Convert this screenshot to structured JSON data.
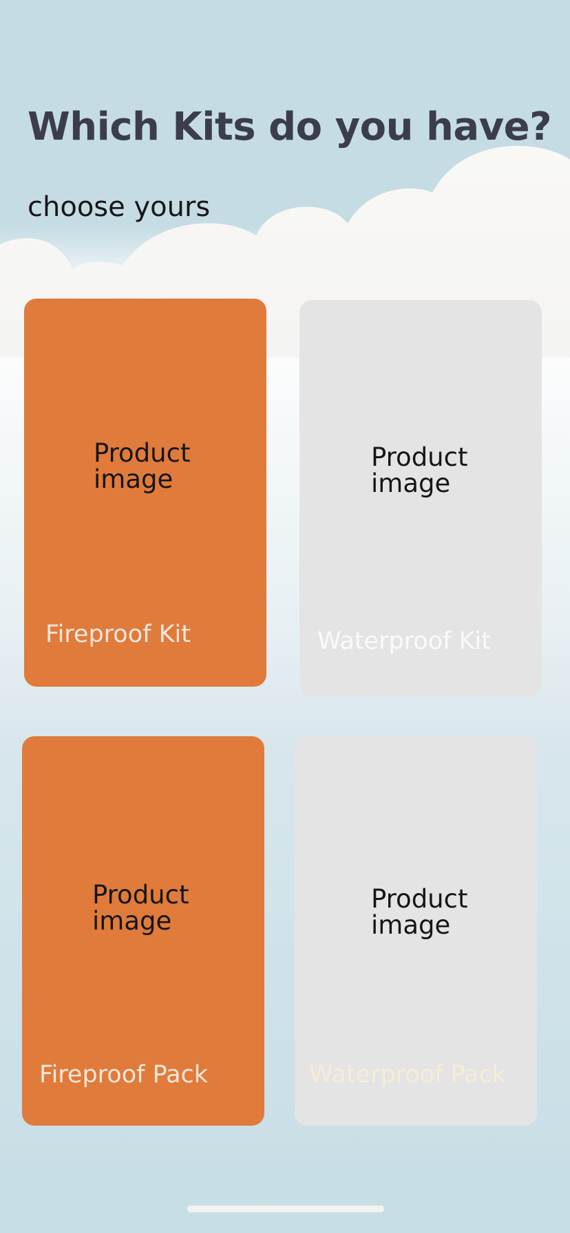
{
  "header": {
    "title": "Which Kits do you have?",
    "subtitle": "choose yours"
  },
  "kits": [
    {
      "label": "Fireproof Kit",
      "image_text": "Product image",
      "selected": true
    },
    {
      "label": "Waterproof Kit",
      "image_text": "Product image",
      "selected": false
    },
    {
      "label": "Fireproof Pack",
      "image_text": "Product image",
      "selected": true
    },
    {
      "label": "Waterproof Pack",
      "image_text": "Product image",
      "selected": false
    }
  ],
  "colors": {
    "selected_card": "#e07b3b",
    "unselected_card": "#e4e4e4",
    "title_text": "#3b3d4d",
    "sky": "#c5dce4"
  }
}
